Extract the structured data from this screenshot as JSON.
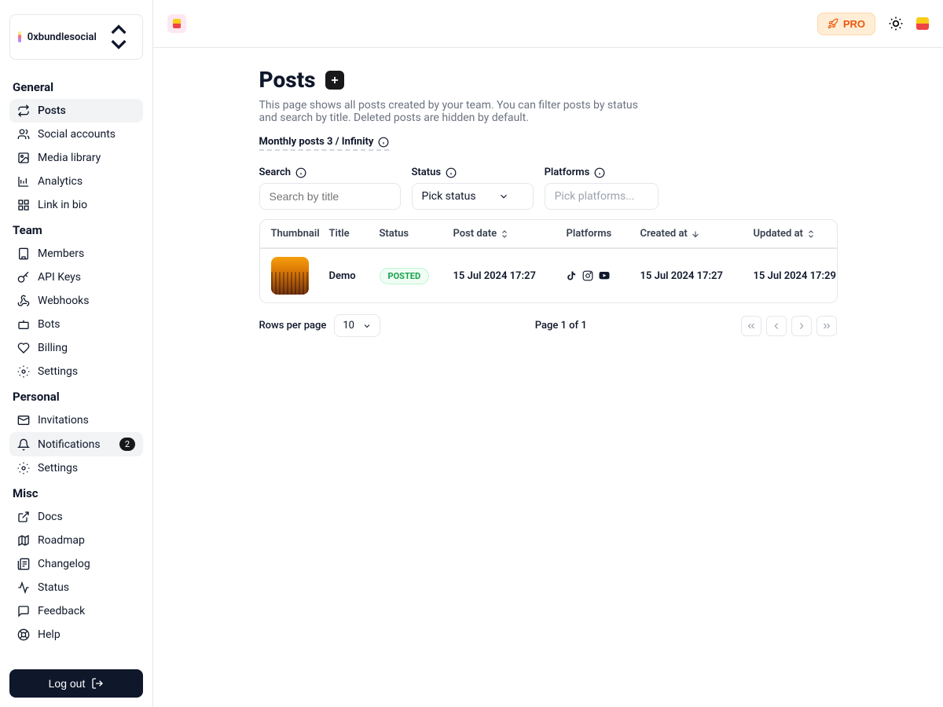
{
  "org": {
    "name": "0xbundlesocial"
  },
  "sidebar": {
    "general_title": "General",
    "team_title": "Team",
    "personal_title": "Personal",
    "misc_title": "Misc",
    "general": [
      {
        "label": "Posts"
      },
      {
        "label": "Social accounts"
      },
      {
        "label": "Media library"
      },
      {
        "label": "Analytics"
      },
      {
        "label": "Link in bio"
      }
    ],
    "team": [
      {
        "label": "Members"
      },
      {
        "label": "API Keys"
      },
      {
        "label": "Webhooks"
      },
      {
        "label": "Bots"
      },
      {
        "label": "Billing"
      },
      {
        "label": "Settings"
      }
    ],
    "personal": [
      {
        "label": "Invitations"
      },
      {
        "label": "Notifications",
        "badge": "2"
      },
      {
        "label": "Settings"
      }
    ],
    "misc": [
      {
        "label": "Docs"
      },
      {
        "label": "Roadmap"
      },
      {
        "label": "Changelog"
      },
      {
        "label": "Status"
      },
      {
        "label": "Feedback"
      },
      {
        "label": "Help"
      }
    ],
    "logout": "Log out"
  },
  "topbar": {
    "pro": "PRO"
  },
  "page": {
    "title": "Posts",
    "description": "This page shows all posts created by your team. You can filter posts by status and search by title. Deleted posts are hidden by default.",
    "monthly": "Monthly posts 3 / Infinity"
  },
  "filters": {
    "search_label": "Search",
    "search_placeholder": "Search by title",
    "status_label": "Status",
    "status_value": "Pick status",
    "platforms_label": "Platforms",
    "platforms_placeholder": "Pick platforms..."
  },
  "table": {
    "columns": {
      "thumbnail": "Thumbnail",
      "title": "Title",
      "status": "Status",
      "post_date": "Post date",
      "platforms": "Platforms",
      "created_at": "Created at",
      "updated_at": "Updated at"
    },
    "rows": [
      {
        "title": "Demo",
        "status": "POSTED",
        "post_date": "15 Jul 2024 17:27",
        "created_at": "15 Jul 2024 17:27",
        "updated_at": "15 Jul 2024 17:29"
      }
    ]
  },
  "pagination": {
    "rows_label": "Rows per page",
    "rows_value": "10",
    "page_info": "Page 1 of 1"
  }
}
